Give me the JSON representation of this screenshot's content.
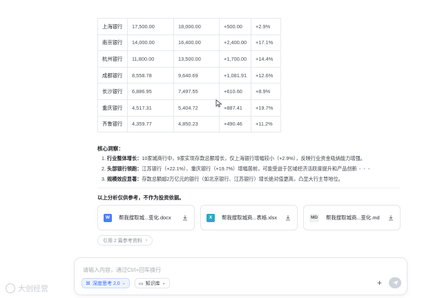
{
  "table": {
    "rows": [
      [
        "上海银行",
        "17,500.00",
        "18,000.00",
        "+500.00",
        "+2.9%"
      ],
      [
        "南京银行",
        "14,000.00",
        "16,400.00",
        "+2,400.00",
        "+17.1%"
      ],
      [
        "杭州银行",
        "11,800.00",
        "13,500.00",
        "+1,700.00",
        "+14.4%"
      ],
      [
        "成都银行",
        "8,558.78",
        "9,640.69",
        "+1,081.91",
        "+12.6%"
      ],
      [
        "长沙银行",
        "6,886.95",
        "7,497.55",
        "+610.60",
        "+8.9%"
      ],
      [
        "重庆银行",
        "4,517.31",
        "5,404.72",
        "+887.41",
        "+19.7%"
      ],
      [
        "齐鲁银行",
        "4,359.77",
        "4,850.23",
        "+490.46",
        "+11.2%"
      ]
    ]
  },
  "insights": {
    "title": "核心洞察：",
    "items": [
      {
        "num": "1.",
        "head": "行业整体增长：",
        "body": "10家城商行中，9家实现存款总额增长，仅上海银行增幅较小（+2.9%），反映行业资金吸纳能力增强。"
      },
      {
        "num": "2.",
        "head": "头部银行领跑：",
        "body": "江苏银行（+22.1%）、重庆银行（+19.7%）增幅居前，可能受益于区域经济活跃度提升和产品创新"
      },
      {
        "num": "3.",
        "head": "规模效应显著：",
        "body": "存款总额超2万亿元的银行（如北京银行、江苏银行）增长绝对值更高，凸显大行主导地位。"
      }
    ]
  },
  "disclaimer": "以上分析仅供参考，不作为投资依据。",
  "files": [
    {
      "icon": "word-doc-icon",
      "badge": "W",
      "name": "帮我搜取城...变化.docx"
    },
    {
      "icon": "excel-icon",
      "badge": "X",
      "name": "帮我搜取城商...表格.xlsx"
    },
    {
      "icon": "markdown-icon",
      "badge": "MD",
      "name": "帮我搜取城商...变化.md"
    }
  ],
  "references": {
    "label": "引用 2 篇参考资料",
    "icon": "chevron-right-icon"
  },
  "input": {
    "placeholder": "请输入内容，通过Ctrl+回车换行",
    "deep_think": "深度思考 2.0",
    "knowledge": "知识库"
  },
  "watermark": "大创经营",
  "colors": {
    "accent": "#3b6cf5",
    "word": "#4a7dff",
    "excel": "#2ea6c9"
  }
}
